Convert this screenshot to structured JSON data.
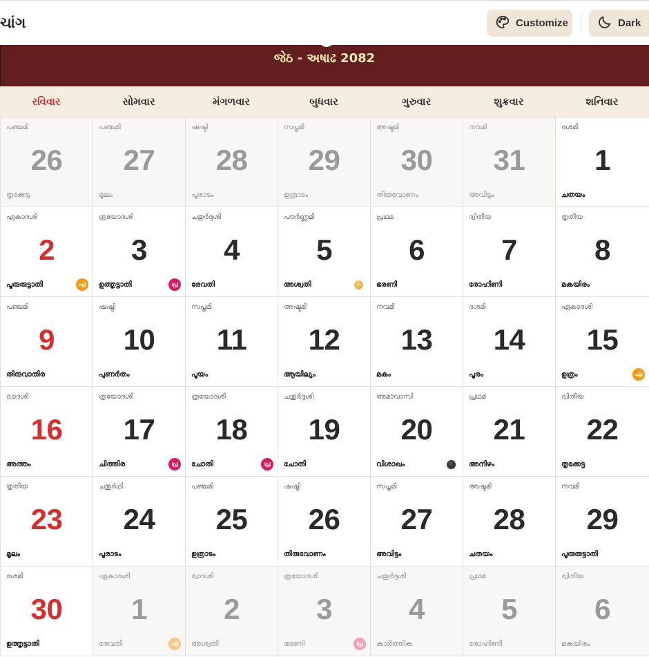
{
  "header": {
    "app_title": "ચાંગ",
    "customize_label": "Customize",
    "dark_label": "Dark"
  },
  "month_title": "જેઠ - અષાઢ 2082",
  "weekdays": [
    "રવિવાર",
    "સોમવાર",
    "મંગળવાર",
    "બુધવાર",
    "ગુરુવાર",
    "શુક્રવાર",
    "શનિવાર"
  ],
  "colors": {
    "header_bg": "#631f1f",
    "month_title": "#ffe5b0",
    "sunday_red": "#d32f2f",
    "weekday_bar": "#f6ede1",
    "button_bg": "#f0e6d8"
  },
  "days": [
    {
      "day": "26",
      "tithi": "പഞ്ചമി",
      "nak": "തൃക്കേട്ട",
      "other": true
    },
    {
      "day": "27",
      "tithi": "പഞ്ചമി",
      "nak": "മൂലം",
      "other": true
    },
    {
      "day": "28",
      "tithi": "ഷഷ്ഠി",
      "nak": "പൂരാടം",
      "other": true
    },
    {
      "day": "29",
      "tithi": "സപ്തമി",
      "nak": "ഉത്രാടം",
      "other": true
    },
    {
      "day": "30",
      "tithi": "അഷ്ടമി",
      "nak": "തിരുവോണം",
      "other": true
    },
    {
      "day": "31",
      "tithi": "നവമി",
      "nak": "അവിട്ടം",
      "other": true
    },
    {
      "day": "1",
      "tithi": "ദശമി",
      "nak": "ചതയം",
      "other": false
    },
    {
      "day": "2",
      "tithi": "ഏകാദശി",
      "nak": "പൂരുരുട്ടാതി",
      "badge": "എ",
      "badge_type": "ekadashi"
    },
    {
      "day": "3",
      "tithi": "ത്രയോദശി",
      "nak": "ഉത്തൃട്ടാതി",
      "badge": "പ്ര",
      "badge_type": "pradosh"
    },
    {
      "day": "4",
      "tithi": "ചതുർദ്ദശി",
      "nak": "രേവതി"
    },
    {
      "day": "5",
      "tithi": "പൗർണ്ണമി",
      "nak": "അശ്വതി",
      "moon": "full"
    },
    {
      "day": "6",
      "tithi": "പ്രഥമ",
      "nak": "ഭരണി"
    },
    {
      "day": "7",
      "tithi": "ദ്വിതീയ",
      "nak": "രോഹിണി"
    },
    {
      "day": "8",
      "tithi": "തൃതീയ",
      "nak": "മകയിരം"
    },
    {
      "day": "9",
      "tithi": "പഞ്ചമി",
      "nak": "തിരുവാതിര"
    },
    {
      "day": "10",
      "tithi": "ഷഷ്ഠി",
      "nak": "പുണർതം"
    },
    {
      "day": "11",
      "tithi": "സപ്തമി",
      "nak": "പൂയം"
    },
    {
      "day": "12",
      "tithi": "അഷ്ടമി",
      "nak": "ആയില്യം"
    },
    {
      "day": "13",
      "tithi": "നവമി",
      "nak": "മകം"
    },
    {
      "day": "14",
      "tithi": "ദശമി",
      "nak": "പൂരം"
    },
    {
      "day": "15",
      "tithi": "ഏകാദശി",
      "nak": "ഉത്രം",
      "badge": "എ",
      "badge_type": "ekadashi"
    },
    {
      "day": "16",
      "tithi": "ദ്വാദശി",
      "nak": "അത്തം"
    },
    {
      "day": "17",
      "tithi": "ത്രയോദശി",
      "nak": "ചിത്തിര",
      "badge": "പ്ര",
      "badge_type": "pradosh"
    },
    {
      "day": "18",
      "tithi": "ത്രയോദശി",
      "nak": "ചോതി",
      "badge": "പ്ര",
      "badge_type": "pradosh"
    },
    {
      "day": "19",
      "tithi": "ചതുർദ്ദശി",
      "nak": "ചോതി"
    },
    {
      "day": "20",
      "tithi": "അമാവാസി",
      "nak": "വിശാഖം",
      "moon": "new"
    },
    {
      "day": "21",
      "tithi": "പ്രഥമ",
      "nak": "അനിഴം"
    },
    {
      "day": "22",
      "tithi": "ദ്വിതീയ",
      "nak": "തൃക്കേട്ട"
    },
    {
      "day": "23",
      "tithi": "തൃതീയ",
      "nak": "മൂലം"
    },
    {
      "day": "24",
      "tithi": "ചതുർഥി",
      "nak": "പൂരാടം"
    },
    {
      "day": "25",
      "tithi": "പഞ്ചമി",
      "nak": "ഉത്രാടം"
    },
    {
      "day": "26",
      "tithi": "ഷഷ്ഠി",
      "nak": "തിരുവോണം"
    },
    {
      "day": "27",
      "tithi": "സപ്തമി",
      "nak": "അവിട്ടം"
    },
    {
      "day": "28",
      "tithi": "അഷ്ടമി",
      "nak": "ചതയം"
    },
    {
      "day": "29",
      "tithi": "നവമി",
      "nak": "പൂരുരുട്ടാതി"
    },
    {
      "day": "30",
      "tithi": "ദശമി",
      "nak": "ഉത്തൃട്ടാതി"
    },
    {
      "day": "1",
      "tithi": "ഏകാദശി",
      "nak": "രേവതി",
      "other": true,
      "badge": "എ",
      "badge_type": "ekadashi"
    },
    {
      "day": "2",
      "tithi": "ദ്വാദശി",
      "nak": "അശ്വതി",
      "other": true
    },
    {
      "day": "3",
      "tithi": "ത്രയോദശി",
      "nak": "ഭരണി",
      "other": true,
      "badge": "പ്ര",
      "badge_type": "pradosh"
    },
    {
      "day": "4",
      "tithi": "ചതുർദ്ദശി",
      "nak": "കാർത്തിക",
      "other": true
    },
    {
      "day": "5",
      "tithi": "പ്രഥമ",
      "nak": "രോഹിണി",
      "other": true
    },
    {
      "day": "6",
      "tithi": "ദ്വിതീയ",
      "nak": "മകയിരം",
      "other": true
    }
  ]
}
